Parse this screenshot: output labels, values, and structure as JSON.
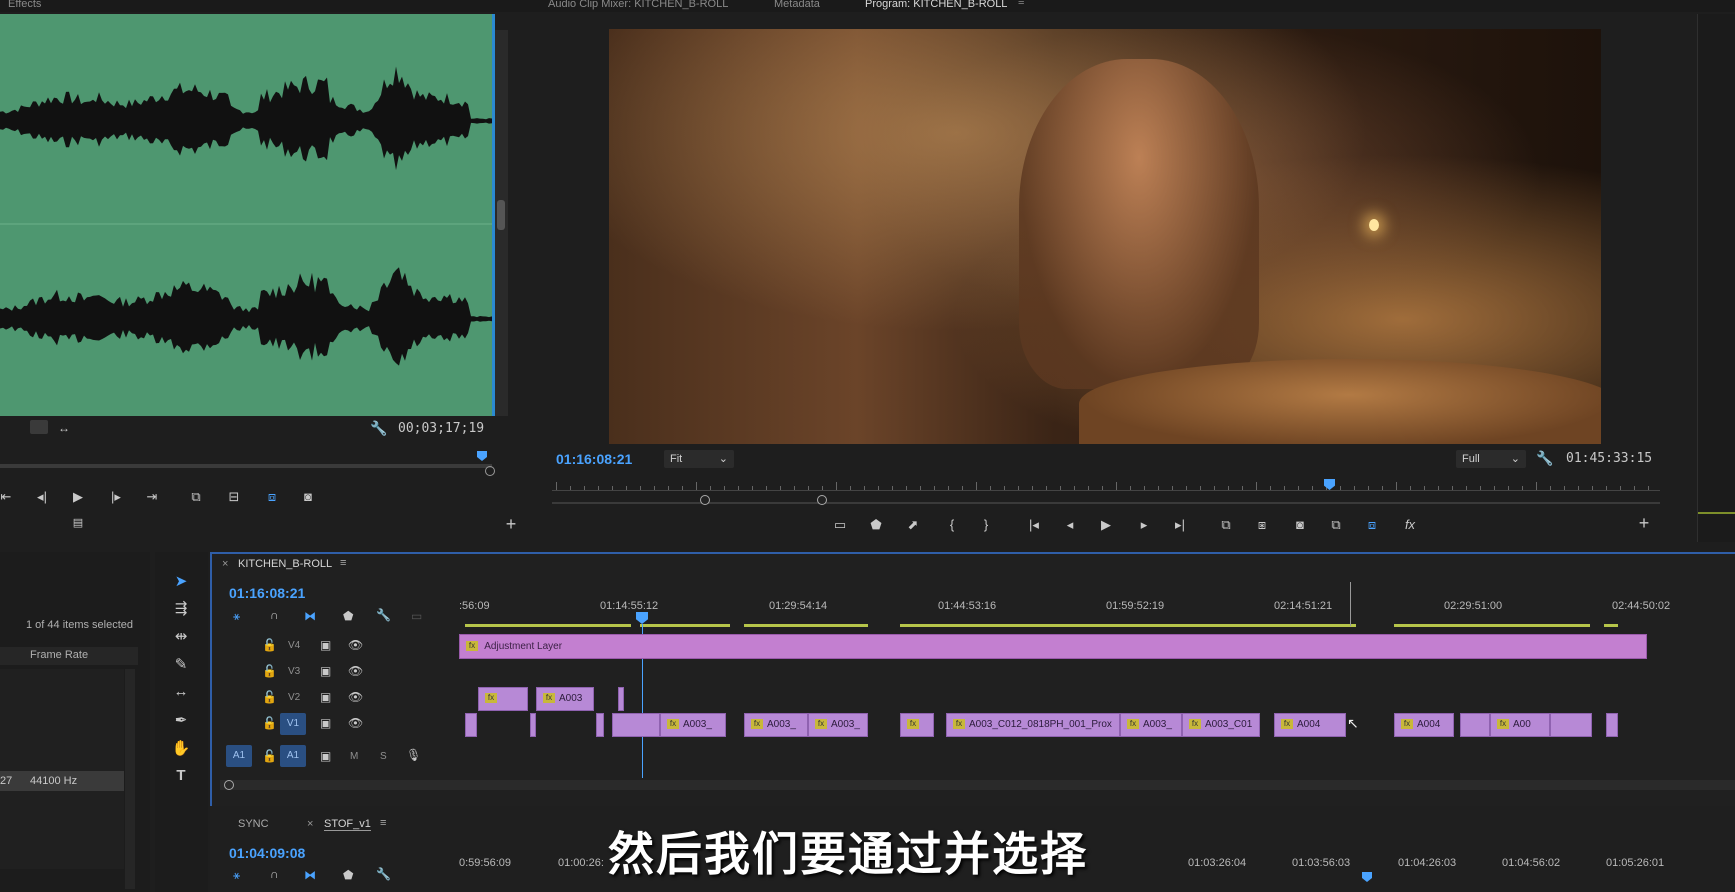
{
  "top_tabs": {
    "effects": "Effects",
    "audio_clip_mixer": "Audio Clip Mixer: KITCHEN_B-ROLL",
    "metadata": "Metadata",
    "program": "Program: KITCHEN_B-ROLL"
  },
  "source_monitor": {
    "timecode": "00;03;17;19"
  },
  "program_monitor": {
    "current_timecode": "01:16:08:21",
    "fit_option": "Fit",
    "resolution_option": "Full",
    "duration_timecode": "01:45:33:15"
  },
  "project_panel": {
    "selection_status": "1 of 44 items selected",
    "column_header": "Frame Rate",
    "row_left": "27",
    "row_rate": "44100 Hz"
  },
  "timeline": {
    "sequence_tab": "KITCHEN_B-ROLL",
    "timecode": "01:16:08:21",
    "ruler_labels": [
      ":56:09",
      "01:14:55:12",
      "01:29:54:14",
      "01:44:53:16",
      "01:59:52:19",
      "02:14:51:21",
      "02:29:51:00",
      "02:44:50:02"
    ],
    "tracks": {
      "v4": "V4",
      "v3": "V3",
      "v2": "V2",
      "v1": "V1",
      "a1_src": "A1",
      "a1": "A1",
      "m": "M",
      "s": "S"
    },
    "adjustment_layer": "Adjustment Layer",
    "fx_badge": "fx",
    "v2_clips": [
      {
        "label": ""
      },
      {
        "label": "A003"
      }
    ],
    "v1_clips": [
      "A003_",
      "A003_",
      "A003_",
      "A003_C012_0818PH_001_Prox",
      "A003_",
      "A003_C01",
      "A004",
      "A004",
      "A00"
    ]
  },
  "second_timeline": {
    "tab_sync": "SYNC",
    "tab_stof": "STOF_v1",
    "timecode": "01:04:09:08",
    "ruler_labels": [
      "0:59:56:09",
      "01:00:26:",
      "01:03:26:04",
      "01:03:56:03",
      "01:04:26:03",
      "01:04:56:02",
      "01:05:26:01"
    ]
  },
  "subtitle": "然后我们要通过并选择",
  "colors": {
    "accent_blue": "#4aa3ff",
    "waveform_bg": "#4e9770",
    "clip_purple": "#b789d6",
    "adjustment_layer": "#c37fd0"
  }
}
